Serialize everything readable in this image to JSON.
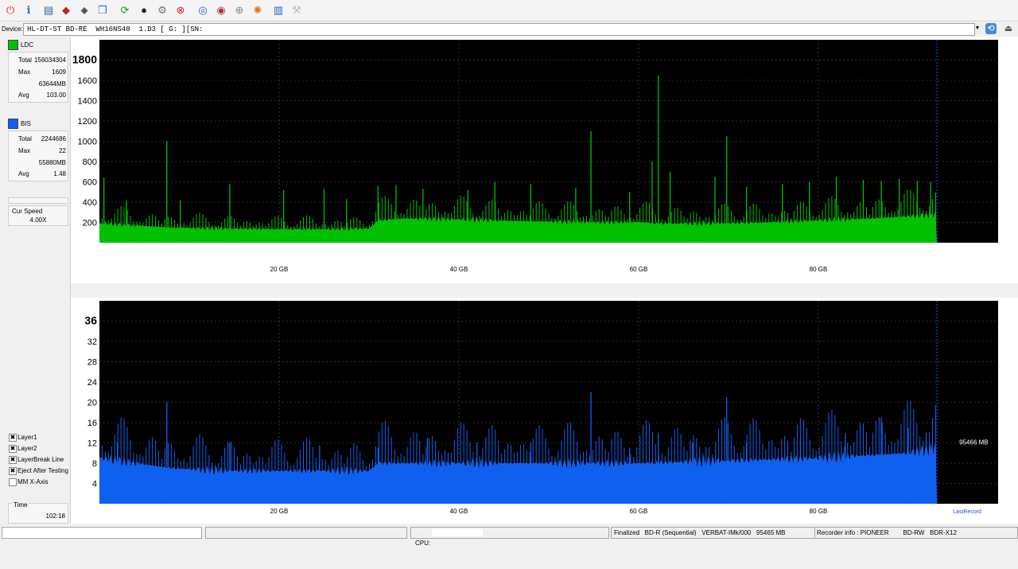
{
  "device": {
    "label": "Device:",
    "value": "HL-DT-ST BD-RE  WH16NS48  1.D3 [ G: ][SN:                ]"
  },
  "ldc": {
    "name": "LDC",
    "total_label": "Total",
    "total": "156034304",
    "max_label": "Max",
    "max": "1609",
    "max_pos": "63644MB",
    "avg_label": "Avg",
    "avg": "103.00",
    "color": "#00c000"
  },
  "bis": {
    "name": "BIS",
    "total_label": "Total",
    "total": "2244686",
    "max_label": "Max",
    "max": "22",
    "max_pos": "55880MB",
    "avg_label": "Avg",
    "avg": "1.48",
    "color": "#1060f0"
  },
  "speed": {
    "label": "Cur Speed",
    "value": "4.00X"
  },
  "options": [
    {
      "label": "Layer1",
      "checked": true
    },
    {
      "label": "Layer2",
      "checked": true
    },
    {
      "label": "LayerBreak Line",
      "checked": true
    },
    {
      "label": "Eject After Testing",
      "checked": true
    },
    {
      "label": "MM X-Axis",
      "checked": false
    }
  ],
  "time": {
    "label": "Time",
    "value": "102:18"
  },
  "status": {
    "cpu_label": "CPU:",
    "disc": "Finalized   BD-R (Sequential)   VERBAT-IMk/000   95465 MB",
    "recorder": "Recorder info : PIONEER        BD-RW   BDR-X12"
  },
  "chart_data": [
    {
      "type": "bar",
      "name": "LDC",
      "color": "#00c000",
      "x_ticks": [
        "20 GB",
        "40 GB",
        "60 GB",
        "80 GB"
      ],
      "x_tick_values": [
        20,
        40,
        60,
        80
      ],
      "xlim": [
        0,
        100
      ],
      "data_end": 93.2,
      "y_ticks": [
        "200",
        "400",
        "600",
        "800",
        "1000",
        "1200",
        "1400",
        "1600",
        "1800"
      ],
      "y_tick_values": [
        200,
        400,
        600,
        800,
        1000,
        1200,
        1400,
        1600,
        1800
      ],
      "ylim": [
        0,
        2000
      ],
      "baseline": [
        [
          0,
          190
        ],
        [
          8,
          150
        ],
        [
          14,
          140
        ],
        [
          20,
          135
        ],
        [
          26,
          135
        ],
        [
          30,
          140
        ],
        [
          31,
          220
        ],
        [
          34,
          240
        ],
        [
          40,
          230
        ],
        [
          46,
          215
        ],
        [
          52,
          205
        ],
        [
          56,
          200
        ],
        [
          60,
          205
        ],
        [
          62,
          190
        ],
        [
          68,
          190
        ],
        [
          74,
          200
        ],
        [
          80,
          220
        ],
        [
          86,
          240
        ],
        [
          90,
          260
        ],
        [
          93.2,
          280
        ]
      ],
      "spikes": [
        [
          0.5,
          640
        ],
        [
          3,
          420
        ],
        [
          7.5,
          1000
        ],
        [
          9,
          420
        ],
        [
          14.5,
          580
        ],
        [
          20.5,
          520
        ],
        [
          25,
          530
        ],
        [
          27.5,
          430
        ],
        [
          31,
          560
        ],
        [
          33,
          570
        ],
        [
          36,
          530
        ],
        [
          41,
          520
        ],
        [
          44,
          600
        ],
        [
          48,
          580
        ],
        [
          53,
          540
        ],
        [
          54.7,
          1100
        ],
        [
          59,
          500
        ],
        [
          62.2,
          1650
        ],
        [
          61.5,
          800
        ],
        [
          63.5,
          700
        ],
        [
          68.5,
          650
        ],
        [
          69.8,
          1050
        ],
        [
          72,
          550
        ],
        [
          76,
          580
        ],
        [
          79,
          600
        ],
        [
          82,
          650
        ],
        [
          85,
          620
        ],
        [
          87,
          610
        ],
        [
          89,
          630
        ],
        [
          91,
          610
        ],
        [
          92.5,
          600
        ]
      ],
      "grid": true
    },
    {
      "type": "bar",
      "name": "BIS",
      "color": "#1060f0",
      "x_ticks": [
        "20 GB",
        "40 GB",
        "60 GB",
        "80 GB"
      ],
      "x_tick_values": [
        20,
        40,
        60,
        80
      ],
      "xlim": [
        0,
        100
      ],
      "data_end": 93.2,
      "y_ticks": [
        "4",
        "8",
        "12",
        "16",
        "20",
        "24",
        "28",
        "32",
        "36"
      ],
      "y_tick_values": [
        4,
        8,
        12,
        16,
        20,
        24,
        28,
        32,
        36
      ],
      "ylim": [
        0,
        40
      ],
      "baseline": [
        [
          0,
          9
        ],
        [
          8,
          7
        ],
        [
          14,
          6.5
        ],
        [
          20,
          6.5
        ],
        [
          26,
          6.5
        ],
        [
          30,
          6.5
        ],
        [
          31,
          8
        ],
        [
          40,
          8
        ],
        [
          50,
          8
        ],
        [
          60,
          8
        ],
        [
          70,
          8.5
        ],
        [
          80,
          9
        ],
        [
          90,
          10
        ],
        [
          93.2,
          11
        ]
      ],
      "spikes": [
        [
          7.5,
          20
        ],
        [
          2,
          12
        ],
        [
          14.5,
          12
        ],
        [
          24.5,
          11.5
        ],
        [
          31,
          11
        ],
        [
          36.5,
          13
        ],
        [
          42,
          12
        ],
        [
          48,
          12
        ],
        [
          54.7,
          22
        ],
        [
          59,
          11
        ],
        [
          62.2,
          14
        ],
        [
          66,
          12
        ],
        [
          69.8,
          21
        ],
        [
          72,
          12
        ],
        [
          78,
          13
        ],
        [
          83,
          14
        ],
        [
          87,
          17
        ],
        [
          90,
          15
        ],
        [
          92,
          14
        ]
      ],
      "annotation": "95466 MB",
      "last_record_label": "LastRecord",
      "grid": true
    }
  ]
}
